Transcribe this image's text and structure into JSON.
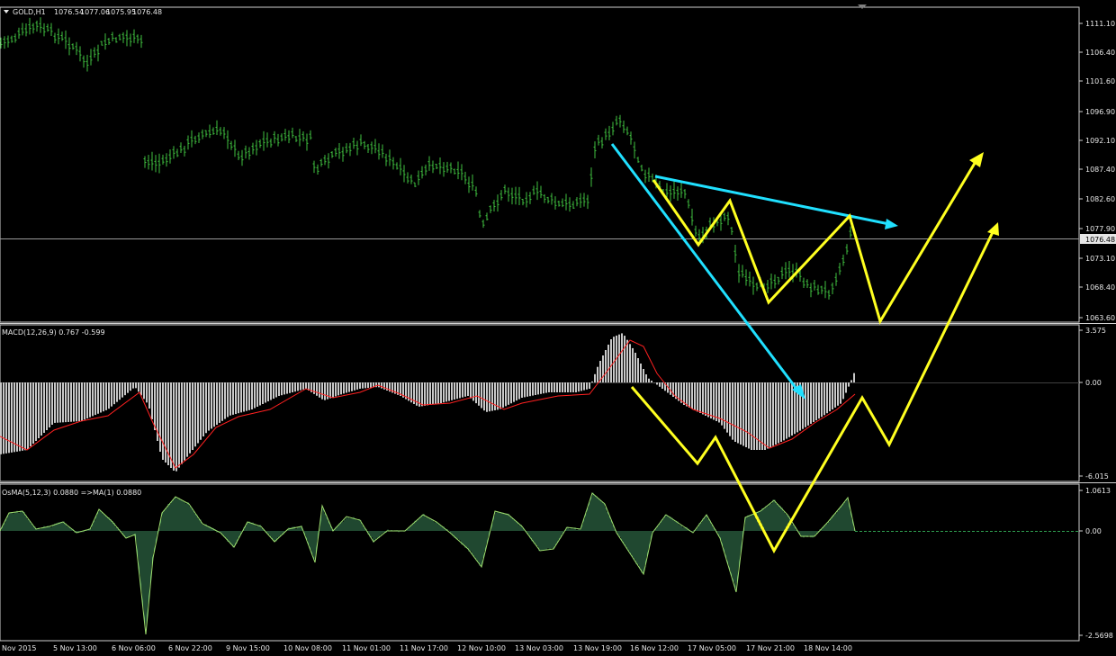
{
  "header": {
    "symbol": "GOLD,H1",
    "open": "1076.54",
    "high": "1077.06",
    "low": "1075.95",
    "close": "1076.48"
  },
  "price_axis": {
    "ticks": [
      "1111.10",
      "1106.40",
      "1101.60",
      "1096.90",
      "1092.10",
      "1087.40",
      "1082.60",
      "1077.90",
      "1073.10",
      "1068.40",
      "1063.60"
    ],
    "current_price": "1076.48"
  },
  "macd": {
    "label": "MACD(12,26,9) 0.767 -0.599",
    "ticks": [
      "3.575",
      "0.00",
      "-6.015"
    ]
  },
  "osma": {
    "label": "OsMA(5,12,3) 0.0880  =>MA(1) 0.0880",
    "ticks": [
      "1.0613",
      "0.00",
      "-2.5698"
    ]
  },
  "time_axis": {
    "labels": [
      "Nov 2015",
      "5 Nov 13:00",
      "6 Nov 06:00",
      "6 Nov 22:00",
      "9 Nov 15:00",
      "10 Nov 08:00",
      "11 Nov 01:00",
      "11 Nov 17:00",
      "12 Nov 10:00",
      "13 Nov 03:00",
      "13 Nov 19:00",
      "16 Nov 12:00",
      "17 Nov 05:00",
      "17 Nov 21:00",
      "18 Nov 14:00"
    ]
  },
  "colors": {
    "background": "#000000",
    "candles": "#3fbf3f",
    "macd_hist": "#c8c8c8",
    "macd_signal": "#ff2020",
    "osma": "#3f8f5f",
    "annotation_yellow": "#ffff20",
    "annotation_cyan": "#20e0ff",
    "axis": "#e6e6e6"
  }
}
